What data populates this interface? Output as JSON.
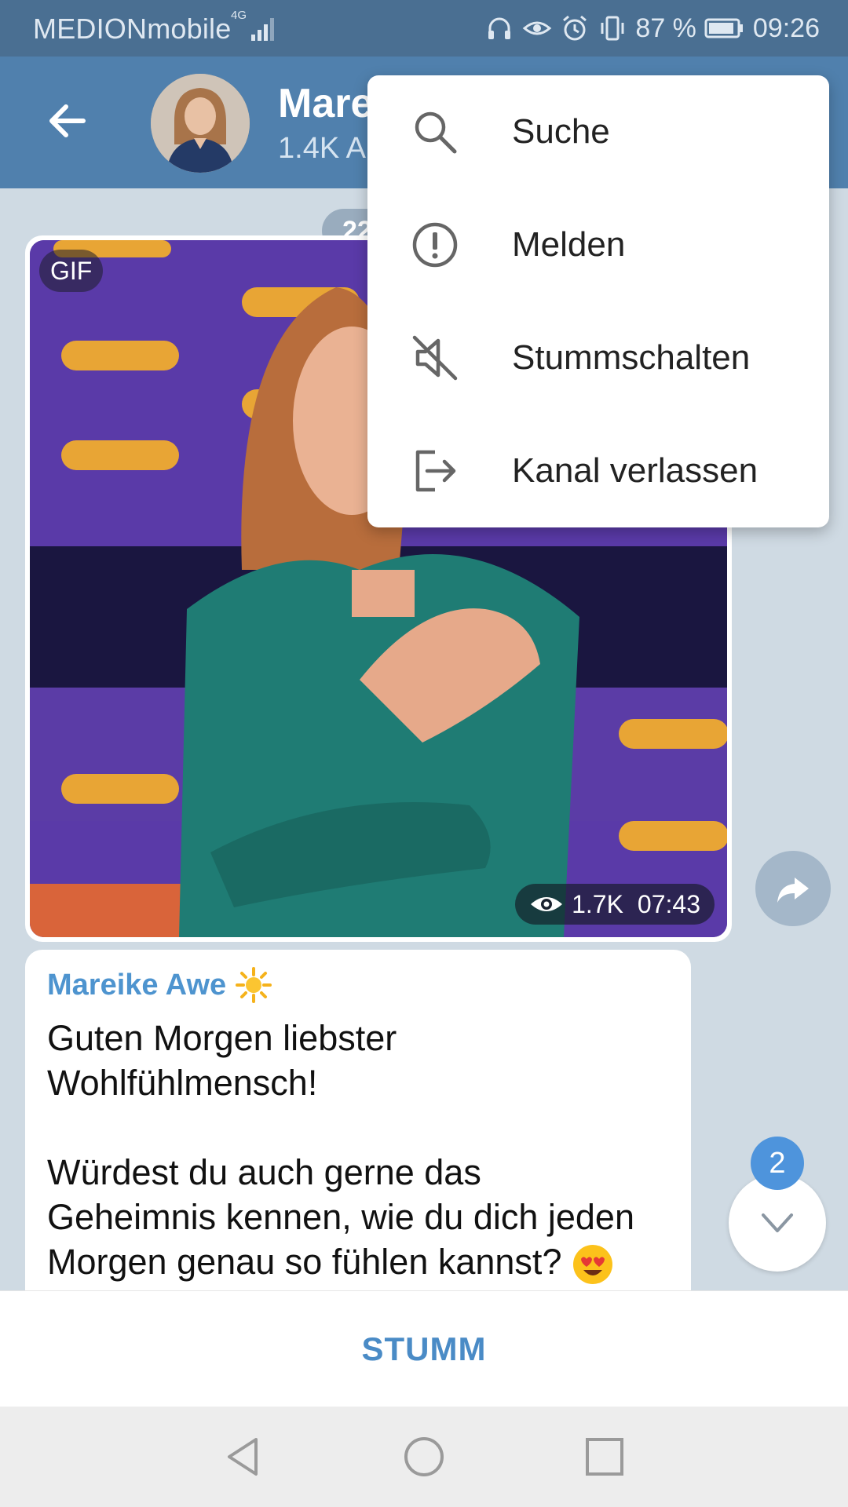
{
  "status_bar": {
    "carrier": "MEDIONmobile",
    "network": "4G",
    "battery": "87 %",
    "time": "09:26",
    "icons": [
      "headset-icon",
      "eye-icon",
      "alarm-icon",
      "vibrate-icon",
      "battery-icon"
    ]
  },
  "header": {
    "title": "Mare",
    "subtitle": "1.4K A"
  },
  "chat": {
    "date_label": "22",
    "media": {
      "gif_label": "GIF",
      "views": "1.7K",
      "time": "07:43"
    },
    "message": {
      "sender": "Mareike Awe",
      "line1": "Guten Morgen liebster",
      "line2": "Wohlfühlmensch!",
      "line3": "Würdest du auch gerne das",
      "line4": "Geheimnis kennen, wie du dich jeden",
      "line5": "Morgen genau so fühlen kannst?"
    },
    "unread_count": "2"
  },
  "bottom_bar": {
    "mute_label": "STUMM"
  },
  "menu": {
    "items": [
      {
        "label": "Suche",
        "icon": "search-icon"
      },
      {
        "label": "Melden",
        "icon": "report-icon"
      },
      {
        "label": "Stummschalten",
        "icon": "mute-icon"
      },
      {
        "label": "Kanal verlassen",
        "icon": "leave-icon"
      }
    ]
  },
  "colors": {
    "status_bar": "#4a6f92",
    "header": "#5080ad",
    "accent": "#4e94cf",
    "chat_bg": "#cfdae3"
  }
}
